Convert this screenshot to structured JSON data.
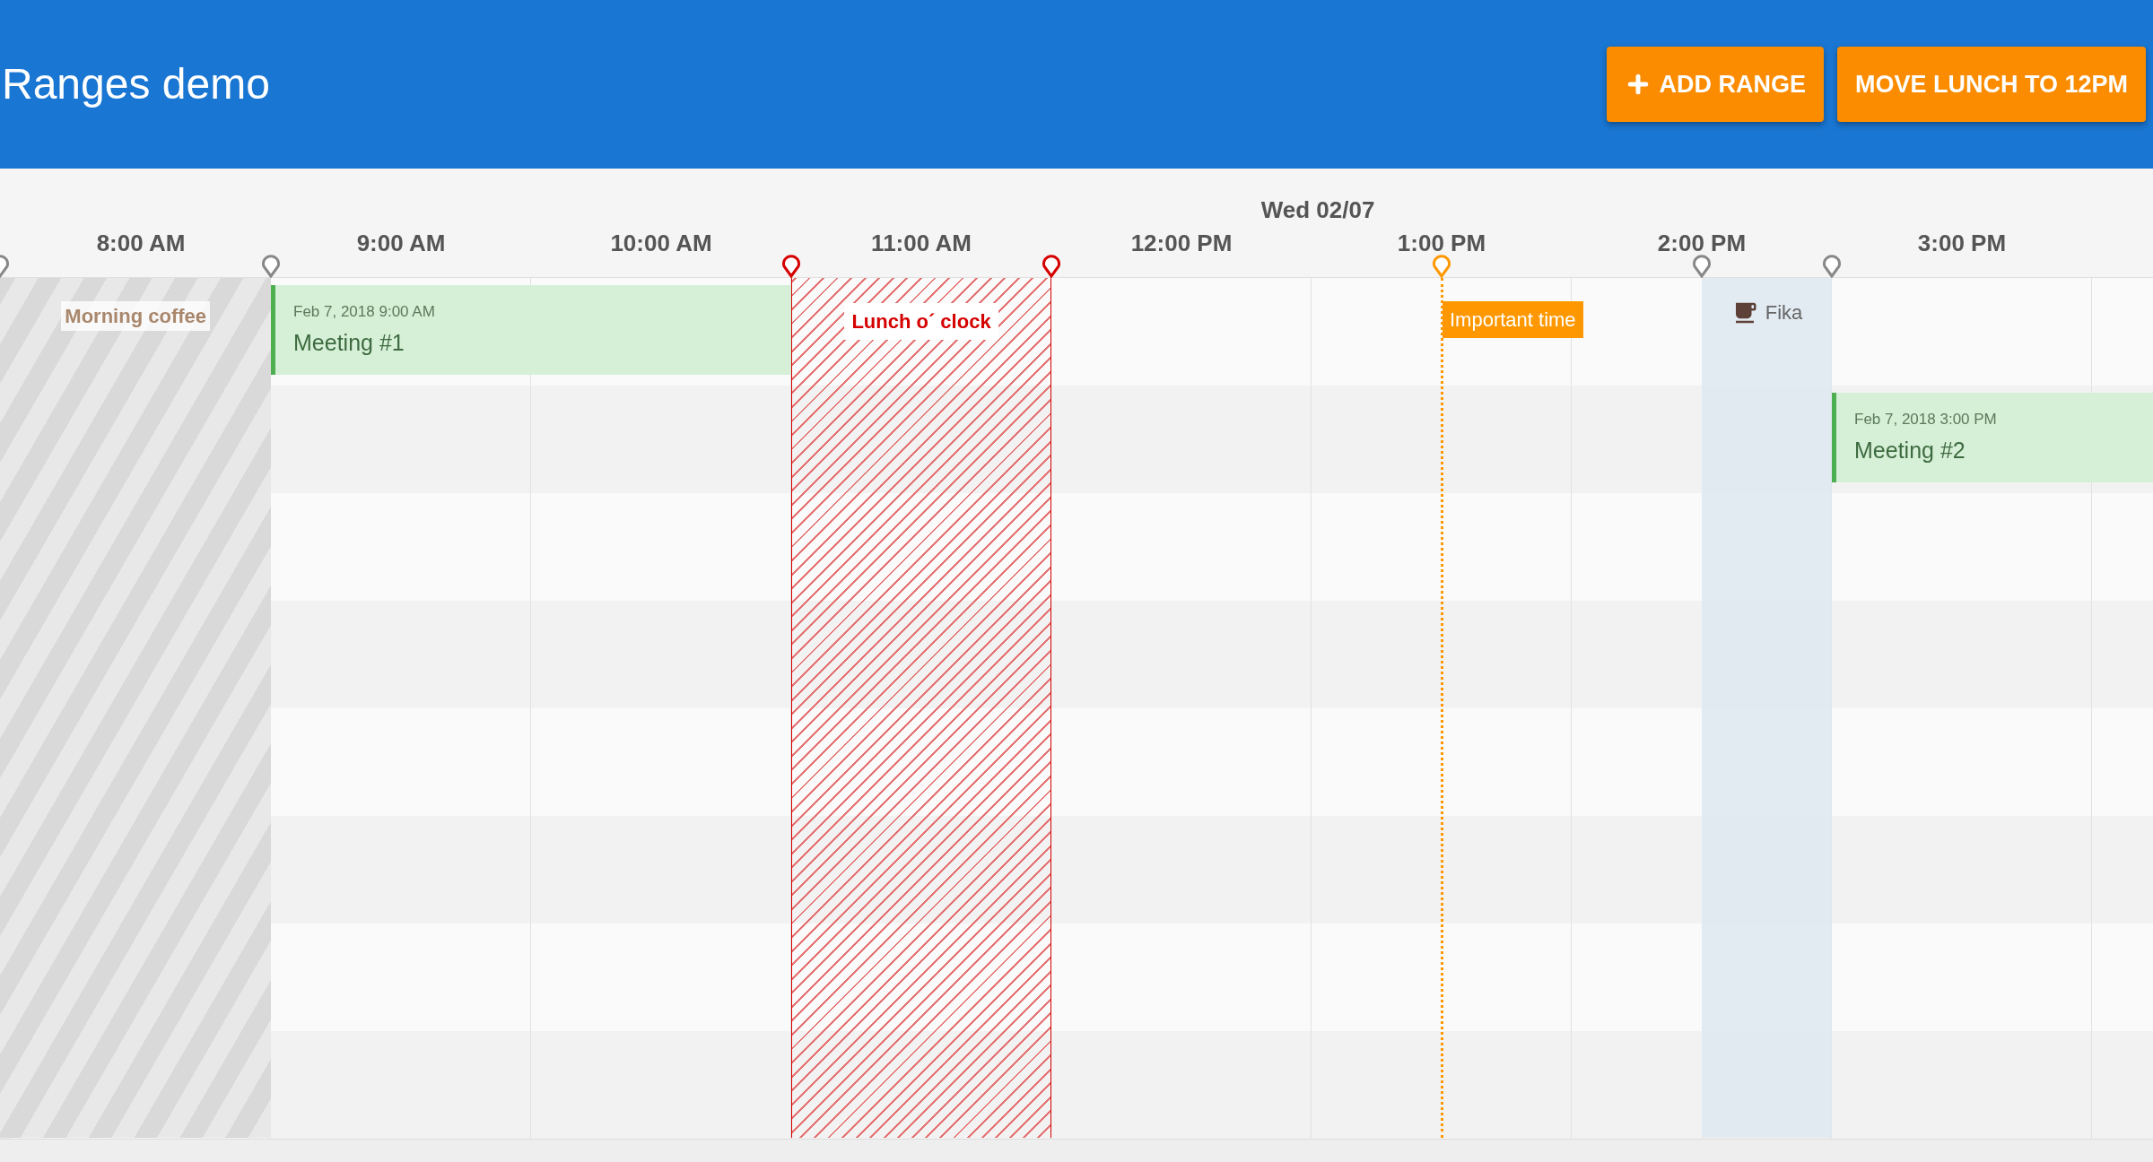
{
  "header": {
    "title": "Ranges demo",
    "buttons": [
      {
        "label": "ADD RANGE"
      },
      {
        "label": "MOVE LUNCH TO 12PM"
      }
    ]
  },
  "timeline": {
    "date": "Wed 02/07",
    "hours": [
      "8:00 AM",
      "9:00 AM",
      "10:00 AM",
      "11:00 AM",
      "12:00 PM",
      "1:00 PM",
      "2:00 PM",
      "3:00 PM"
    ],
    "ranges": [
      {
        "kind": "shaded",
        "label": "Morning coffee",
        "color": "#888888"
      },
      {
        "kind": "hatched",
        "label": "Lunch o´ clock",
        "color": "#d50000"
      },
      {
        "kind": "line",
        "label": "Important time",
        "color": "#ff9800"
      },
      {
        "kind": "tinted",
        "label": "Fika",
        "color": "#888888"
      }
    ],
    "events": [
      {
        "date": "Feb 7, 2018 9:00 AM",
        "title": "Meeting #1"
      },
      {
        "date": "Feb 7, 2018 3:00 PM",
        "title": "Meeting #2"
      }
    ]
  }
}
